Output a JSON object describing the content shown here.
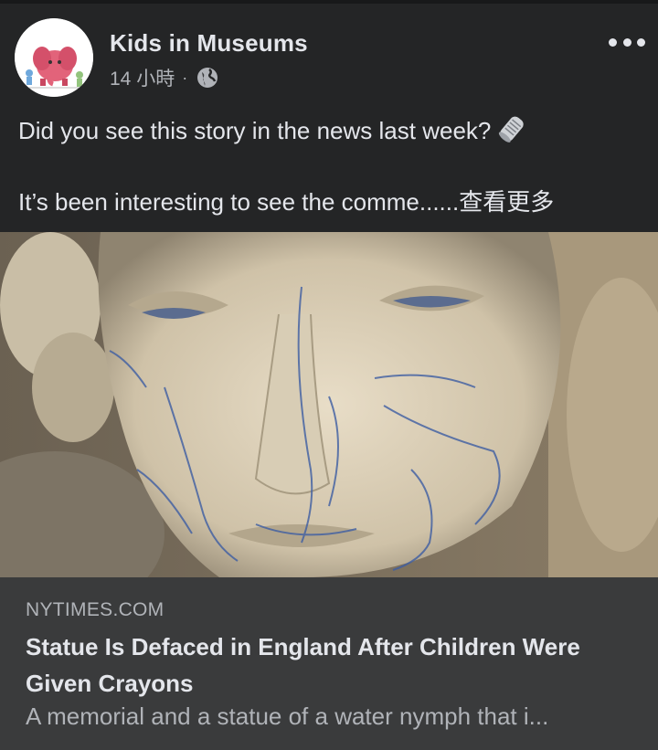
{
  "post": {
    "page_name": "Kids in Museums",
    "time": "14 小時",
    "separator": "·",
    "privacy_icon": "globe-icon",
    "more_icon": "ellipsis-icon",
    "avatar_icon": "kids-in-museums-logo",
    "avatar_logo_text": "Kids in Museums",
    "text_line1": "Did you see this story in the news last week?",
    "text_line1_emoji": "rolled-newspaper-icon",
    "text_line2": "It’s been interesting to see the comme......",
    "see_more": "查看更多"
  },
  "link_preview": {
    "domain": "NYTIMES.COM",
    "title": "Statue Is Defaced in England After Children Were Given Crayons",
    "description": "A memorial and a statue of a water nymph that i..."
  },
  "colors": {
    "background": "#242526",
    "card": "#3a3b3c",
    "primary_text": "#e4e6eb",
    "secondary_text": "#b0b3b8"
  }
}
